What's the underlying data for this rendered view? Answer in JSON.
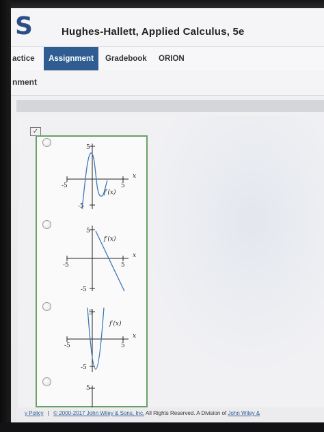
{
  "header": {
    "logo_text": "S",
    "site_title": "Hughes-Hallett, Applied Calculus, 5e"
  },
  "nav": {
    "tabs": [
      {
        "label": "actice"
      },
      {
        "label": "Assignment"
      },
      {
        "label": "Gradebook"
      },
      {
        "label": "ORION"
      }
    ]
  },
  "section": {
    "label": "nment"
  },
  "options": [
    {
      "graph": {
        "y_top": "5",
        "y_bottom": "-5",
        "x_left": "-5",
        "x_right": "5",
        "x_axis": "x",
        "curve_label": "f′(x)"
      }
    },
    {
      "graph": {
        "y_top": "5",
        "y_bottom": "-5",
        "x_left": "-5",
        "x_right": "5",
        "x_axis": "x",
        "curve_label": "f′(x)"
      }
    },
    {
      "graph": {
        "y_top": "5",
        "y_bottom": "-5",
        "x_left": "-5",
        "x_right": "5",
        "x_axis": "x",
        "curve_label": "f′(x)"
      }
    },
    {
      "graph": {
        "y_top": "5"
      }
    }
  ],
  "footer": {
    "policy_link": "y Policy",
    "separator": "|",
    "copyright_link": "© 2000-2017 John Wiley & Sons, Inc.",
    "rights_text": " All Rights Reserved. A Division of ",
    "company_link": "John Wiley &"
  },
  "colors": {
    "brand_blue": "#2f5d92",
    "logo_blue": "#2a4f86",
    "panel_border": "#6aa167",
    "curve_blue": "#3c77b8"
  }
}
